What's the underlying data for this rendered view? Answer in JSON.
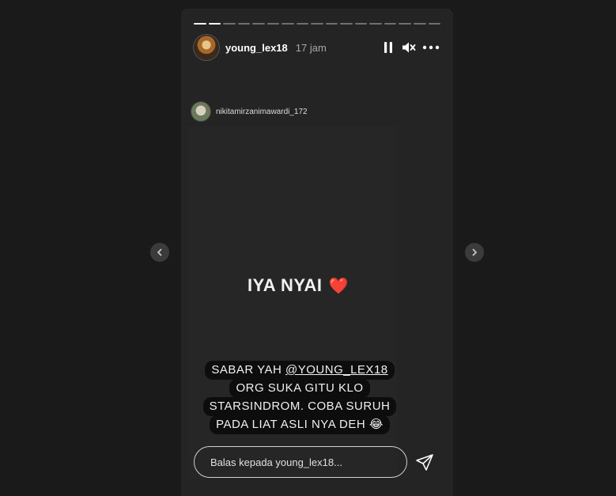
{
  "story": {
    "progress": {
      "total": 17,
      "viewed": 2
    },
    "header": {
      "username": "young_lex18",
      "time": "17 jam"
    },
    "shared_post": {
      "username": "nikitamirzanimawardi_172"
    },
    "main_text": "IYA NYAI",
    "caption": {
      "line1_prefix": "SABAR YAH ",
      "line1_mention": "@YOUNG_LEX18",
      "line2": "ORG SUKA GITU KLO",
      "line3": "STARSINDROM. COBA SURUH",
      "line4": "PADA LIAT ASLI NYA DEH 😂"
    },
    "reply": {
      "placeholder": "Balas kepada young_lex18..."
    }
  },
  "icons": {
    "pause": "pause-icon",
    "mute": "volume-muted-icon",
    "more": "more-options-icon",
    "send": "send-icon",
    "prev": "chevron-left-icon",
    "next": "chevron-right-icon",
    "heart": "heart-icon"
  },
  "colors": {
    "background": "#1a1a1a",
    "card": "#242424",
    "heart": "#e62a2a"
  }
}
